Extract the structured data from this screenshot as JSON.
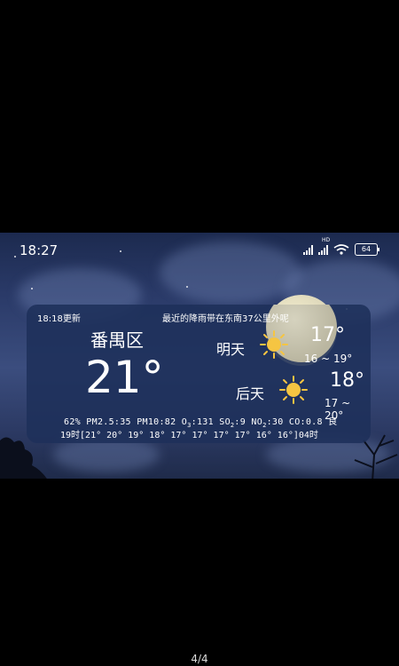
{
  "status": {
    "time": "18:27",
    "hd_label": "HD",
    "battery": "64"
  },
  "widget": {
    "updated": "18:18更新",
    "alert": "最近的降雨带在东南37公里外呢",
    "district": "番禺区",
    "current_temp": "21°",
    "forecast": [
      {
        "day": "明天",
        "temp": "17°",
        "range": "16 ~ 19°",
        "icon": "sun-icon"
      },
      {
        "day": "后天",
        "temp": "18°",
        "range": "17 ~ 20°",
        "icon": "sun-icon"
      }
    ],
    "humidity": "62%",
    "pm25": "PM2.5:35",
    "pm10": "PM10:82",
    "o3_label": "O",
    "o3_sub": "3",
    "o3_value": ":131",
    "so2_label": "SO",
    "so2_sub": "2",
    "so2_value": ":9",
    "no2_label": "NO",
    "no2_sub": "2",
    "no2_value": ":30",
    "co": "CO:0.8",
    "aqi": "良",
    "hourly": "19时[21° 20° 19° 18° 17° 17° 17° 17° 16° 16°]04时"
  },
  "pager": "4/4",
  "colors": {
    "widget_bg": "#1e305a",
    "sun": "#f5c542"
  }
}
